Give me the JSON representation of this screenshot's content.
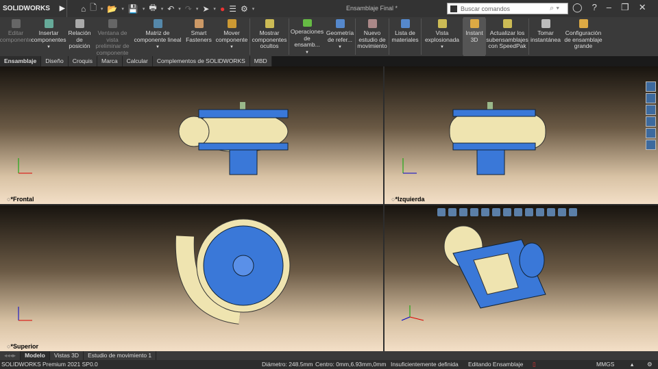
{
  "app": {
    "logo": "SOLIDWORKS",
    "title": "Ensamblaje Final *",
    "search_placeholder": "Buscar comandos"
  },
  "ribbon": [
    {
      "label": "Editar componente",
      "enabled": false,
      "dropdown": false
    },
    {
      "label": "Insertar componentes",
      "enabled": true,
      "dropdown": true
    },
    {
      "label": "Relación de posición",
      "enabled": true,
      "dropdown": false
    },
    {
      "label": "Ventana de vista preliminar de componente",
      "enabled": false,
      "dropdown": false
    },
    {
      "label": "Matriz de componente lineal",
      "enabled": true,
      "dropdown": true
    },
    {
      "label": "Smart Fasteners",
      "enabled": true,
      "dropdown": false
    },
    {
      "label": "Mover componente",
      "enabled": true,
      "dropdown": true
    },
    {
      "label": "Mostrar componentes ocultos",
      "enabled": true,
      "dropdown": false
    },
    {
      "label": "Operaciones de ensamb...",
      "enabled": true,
      "dropdown": true
    },
    {
      "label": "Geometría de refer...",
      "enabled": true,
      "dropdown": true
    },
    {
      "label": "Nuevo estudio de movimiento",
      "enabled": true,
      "dropdown": false
    },
    {
      "label": "Lista de materiales",
      "enabled": true,
      "dropdown": false
    },
    {
      "label": "Vista explosionada",
      "enabled": true,
      "dropdown": true
    },
    {
      "label": "Instant 3D",
      "enabled": true,
      "dropdown": false
    },
    {
      "label": "Actualizar los subensamblajes con SpeedPak",
      "enabled": true,
      "dropdown": false
    },
    {
      "label": "Tomar instantánea",
      "enabled": true,
      "dropdown": false
    },
    {
      "label": "Configuración de ensamblaje grande",
      "enabled": true,
      "dropdown": false
    }
  ],
  "tabs": [
    "Ensamblaje",
    "Diseño",
    "Croquis",
    "Marca",
    "Calcular",
    "Complementos de SOLIDWORKS",
    "MBD"
  ],
  "viewports": {
    "front": "*Frontal",
    "left": "*Izquierda",
    "top": "*Superior"
  },
  "bottom_tabs": [
    "Modelo",
    "Vistas 3D",
    "Estudio de movimiento 1"
  ],
  "status": {
    "product": "SOLIDWORKS Premium 2021 SP0.0",
    "diameter": "Diámetro: 248.5mm",
    "center": "Centro: 0mm,6.93mm,0mm",
    "definition": "Insuficientemente definida",
    "mode": "Editando Ensamblaje",
    "units": "MMGS"
  },
  "colors": {
    "part_blue": "#3a78d8",
    "part_cream": "#efe4b0"
  }
}
